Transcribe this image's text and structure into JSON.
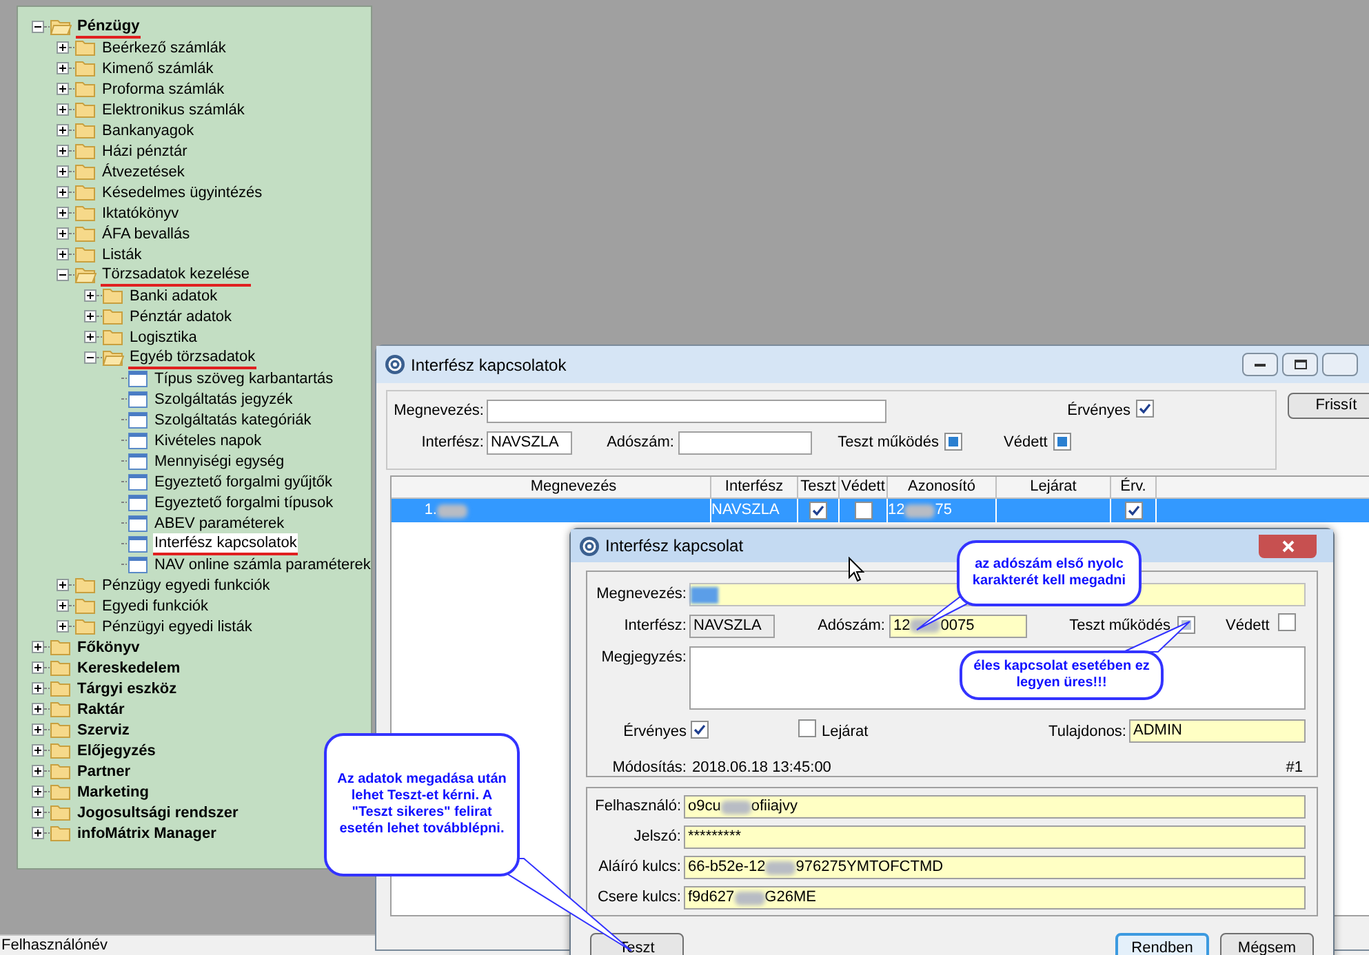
{
  "tree": [
    {
      "label": "Pénzügy",
      "kind": "folder",
      "expanded": true,
      "selected": false,
      "underlined": true,
      "children": [
        {
          "label": "Beérkező számlák",
          "kind": "folder",
          "expanded": false,
          "selected": false,
          "underlined": false
        },
        {
          "label": "Kimenő számlák",
          "kind": "folder",
          "expanded": false,
          "selected": false,
          "underlined": false
        },
        {
          "label": "Proforma számlák",
          "kind": "folder",
          "expanded": false,
          "selected": false,
          "underlined": false
        },
        {
          "label": "Elektronikus számlák",
          "kind": "folder",
          "expanded": false,
          "selected": false,
          "underlined": false
        },
        {
          "label": "Bankanyagok",
          "kind": "folder",
          "expanded": false,
          "selected": false,
          "underlined": false
        },
        {
          "label": "Házi pénztár",
          "kind": "folder",
          "expanded": false,
          "selected": false,
          "underlined": false
        },
        {
          "label": "Átvezetések",
          "kind": "folder",
          "expanded": false,
          "selected": false,
          "underlined": false
        },
        {
          "label": "Késedelmes ügyintézés",
          "kind": "folder",
          "expanded": false,
          "selected": false,
          "underlined": false
        },
        {
          "label": "Iktatókönyv",
          "kind": "folder",
          "expanded": false,
          "selected": false,
          "underlined": false
        },
        {
          "label": "ÁFA bevallás",
          "kind": "folder",
          "expanded": false,
          "selected": false,
          "underlined": false
        },
        {
          "label": "Listák",
          "kind": "folder",
          "expanded": false,
          "selected": false,
          "underlined": false
        },
        {
          "label": "Törzsadatok kezelése",
          "kind": "folder",
          "expanded": true,
          "selected": false,
          "underlined": true,
          "children": [
            {
              "label": "Banki adatok",
              "kind": "folder",
              "expanded": false,
              "selected": false,
              "underlined": false
            },
            {
              "label": "Pénztár adatok",
              "kind": "folder",
              "expanded": false,
              "selected": false,
              "underlined": false
            },
            {
              "label": "Logisztika",
              "kind": "folder",
              "expanded": false,
              "selected": false,
              "underlined": false
            },
            {
              "label": "Egyéb törzsadatok",
              "kind": "folder",
              "expanded": true,
              "selected": false,
              "underlined": true,
              "children": [
                {
                  "label": "Típus szöveg karbantartás",
                  "kind": "page",
                  "selected": false,
                  "underlined": false
                },
                {
                  "label": "Szolgáltatás jegyzék",
                  "kind": "page",
                  "selected": false,
                  "underlined": false
                },
                {
                  "label": "Szolgáltatás kategóriák",
                  "kind": "page",
                  "selected": false,
                  "underlined": false
                },
                {
                  "label": "Kivételes napok",
                  "kind": "page",
                  "selected": false,
                  "underlined": false
                },
                {
                  "label": "Mennyiségi egység",
                  "kind": "page",
                  "selected": false,
                  "underlined": false
                },
                {
                  "label": "Egyeztető forgalmi gyűjtők",
                  "kind": "page",
                  "selected": false,
                  "underlined": false
                },
                {
                  "label": "Egyeztető forgalmi típusok",
                  "kind": "page",
                  "selected": false,
                  "underlined": false
                },
                {
                  "label": "ABEV paraméterek",
                  "kind": "page",
                  "selected": false,
                  "underlined": false
                },
                {
                  "label": "Interfész kapcsolatok",
                  "kind": "page",
                  "selected": true,
                  "underlined": true
                },
                {
                  "label": "NAV online számla paraméterek",
                  "kind": "page",
                  "selected": false,
                  "underlined": false
                }
              ]
            }
          ]
        },
        {
          "label": "Pénzügy egyedi funkciók",
          "kind": "folder",
          "expanded": false,
          "selected": false,
          "underlined": false
        },
        {
          "label": "Egyedi funkciók",
          "kind": "folder",
          "expanded": false,
          "selected": false,
          "underlined": false
        },
        {
          "label": "Pénzügyi egyedi listák",
          "kind": "folder",
          "expanded": false,
          "selected": false,
          "underlined": false
        }
      ]
    },
    {
      "label": "Főkönyv",
      "kind": "folder",
      "expanded": false,
      "selected": false,
      "underlined": false
    },
    {
      "label": "Kereskedelem",
      "kind": "folder",
      "expanded": false,
      "selected": false,
      "underlined": false
    },
    {
      "label": "Tárgyi eszköz",
      "kind": "folder",
      "expanded": false,
      "selected": false,
      "underlined": false
    },
    {
      "label": "Raktár",
      "kind": "folder",
      "expanded": false,
      "selected": false,
      "underlined": false
    },
    {
      "label": "Szerviz",
      "kind": "folder",
      "expanded": false,
      "selected": false,
      "underlined": false
    },
    {
      "label": "Előjegyzés",
      "kind": "folder",
      "expanded": false,
      "selected": false,
      "underlined": false
    },
    {
      "label": "Partner",
      "kind": "folder",
      "expanded": false,
      "selected": false,
      "underlined": false
    },
    {
      "label": "Marketing",
      "kind": "folder",
      "expanded": false,
      "selected": false,
      "underlined": false
    },
    {
      "label": "Jogosultsági rendszer",
      "kind": "folder",
      "expanded": false,
      "selected": false,
      "underlined": false
    },
    {
      "label": "infoMátrix Manager",
      "kind": "folder",
      "expanded": false,
      "selected": false,
      "underlined": false
    }
  ],
  "list_window": {
    "title": "Interfész kapcsolatok",
    "filter": {
      "name_label": "Megnevezés:",
      "valid_label": "Érvényes",
      "valid_checked": true,
      "interface_label": "Interfész:",
      "interface_value": "NAVSZLA",
      "tax_label": "Adószám:",
      "test_label": "Teszt működés",
      "test_grayed": true,
      "protected_label": "Védett",
      "protected_grayed": true
    },
    "refresh_button": "Frissít",
    "table": {
      "columns": [
        "Megnevezés",
        "Interfész",
        "Teszt",
        "Védett",
        "Azonosító",
        "Lejárat",
        "Érv."
      ],
      "rows": [
        {
          "number": "1.",
          "interface": "NAVSZLA",
          "test_checked": true,
          "protected_checked": false,
          "id_start": "12",
          "id_end": "75",
          "valid_checked": true,
          "selected": true
        }
      ]
    }
  },
  "detail_window": {
    "title": "Interfész kapcsolat",
    "name_label": "Megnevezés:",
    "interface_label": "Interfész:",
    "interface_value": "NAVSZLA",
    "tax_label": "Adószám:",
    "tax_start": "12",
    "tax_end": "0075",
    "test_label": "Teszt működés",
    "test_grayed": true,
    "protected_label": "Védett",
    "protected_checked": false,
    "note_label": "Megjegyzés:",
    "valid_label": "Érvényes",
    "valid_checked": true,
    "expiry_label": "Lejárat",
    "expiry_checked": false,
    "owner_label": "Tulajdonos:",
    "owner_value": "ADMIN",
    "modified_label": "Módosítás:",
    "modified_value": "2018.06.18 13:45:00",
    "counter": "#1",
    "credentials": [
      {
        "label": "Felhasználó:",
        "start": "o9cu",
        "end": "ofiiajvy"
      },
      {
        "label": "Jelszó:",
        "start": "*********"
      },
      {
        "label": "Aláíró kulcs:",
        "start": "66-b52e-12",
        "end": "976275YMTOFCTMD"
      },
      {
        "label": "Csere kulcs:",
        "start": "f9d627",
        "end": "G26ME"
      }
    ],
    "buttons": [
      {
        "label": "Teszt",
        "default": false
      },
      {
        "label": "Rendben",
        "default": true
      },
      {
        "label": "Mégsem",
        "default": false
      }
    ]
  },
  "callouts": [
    {
      "text": "az adószám első nyolc karakterét kell megadni"
    },
    {
      "text": "éles kapcsolat esetében ez legyen üres!!!"
    },
    {
      "text": "Az adatok megadása után lehet Teszt-et kérni. A \"Teszt sikeres\" felirat esetén lehet továbblépni."
    }
  ],
  "status_bar": {
    "text": "Felhasználónév"
  }
}
